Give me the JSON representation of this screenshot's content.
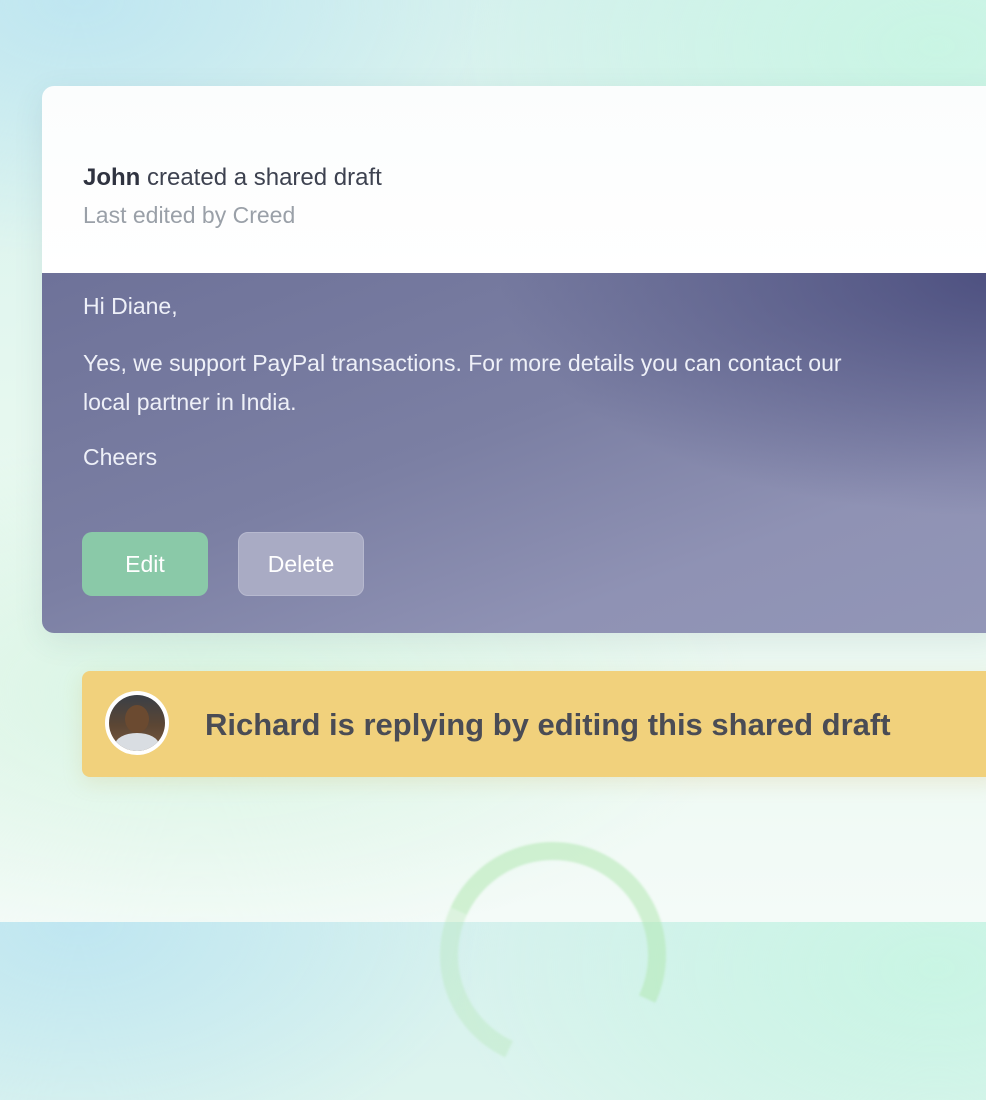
{
  "draft_card": {
    "header": {
      "author": "John",
      "action": " created a shared draft",
      "last_edited": "Last edited by Creed"
    },
    "message": {
      "greeting": "Hi Diane,",
      "body": "Yes, we support PayPal transactions. For more details you can contact our local partner in India.",
      "signoff": "Cheers"
    },
    "buttons": {
      "edit_label": "Edit",
      "delete_label": "Delete"
    }
  },
  "reply_banner": {
    "text": "Richard is replying by editing this shared draft",
    "avatar_icon": "user-avatar"
  },
  "colors": {
    "edit_button": "#8ac9a8",
    "delete_button": "#a9abc4",
    "banner": "#f1d17c",
    "body_dark": "#4d5080",
    "body_light": "#9296b7"
  }
}
